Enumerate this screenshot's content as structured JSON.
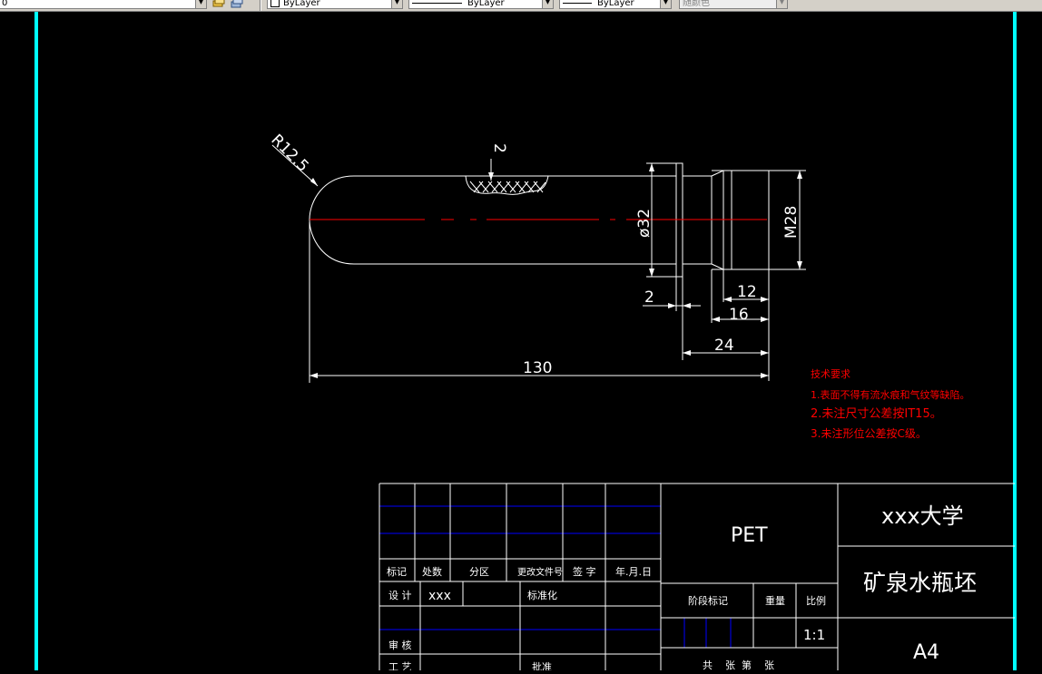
{
  "toolbar": {
    "layer_value": "0",
    "color_value": "ByLayer",
    "linetype_value": "ByLayer",
    "lineweight_value": "ByLayer",
    "plotstyle_value": "随颜色"
  },
  "drawing": {
    "dimensions": {
      "radius": "R12.5",
      "thread_depth": "2",
      "diameter": "ø32",
      "thread": "M28",
      "flange": "2",
      "d12": "12",
      "d16": "16",
      "d24": "24",
      "total": "130"
    },
    "tech_requirements": {
      "title": "技术要求",
      "item1": "1.表面不得有流水痕和气纹等缺陷。",
      "item2": "2.未注尺寸公差按IT15。",
      "item3": "3.未注形位公差按C级。"
    }
  },
  "title_block": {
    "material": "PET",
    "school": "xxx大学",
    "part_name": "矿泉水瓶坯",
    "paper": "A4",
    "header_mark": "标记",
    "header_count": "处数",
    "header_zone": "分区",
    "header_docno": "更改文件号",
    "header_sign": "签 字",
    "header_date": "年.月.日",
    "design_label": "设 计",
    "design_value": "xxx",
    "standard_label": "标准化",
    "review_label": "审 核",
    "craft_label": "工 艺",
    "approve_label": "批准",
    "stage_label": "阶段标记",
    "weight_label": "重量",
    "scale_label": "比例",
    "scale_value": "1:1",
    "sheets_label": "共    张  第    张"
  },
  "colors": {
    "background": "#000000",
    "line": "#ffffff",
    "center_line": "#ff0000",
    "border_cyan": "#00ffff",
    "title_grid_blue": "#0000ff",
    "tech_text_red": "#ff0000"
  }
}
